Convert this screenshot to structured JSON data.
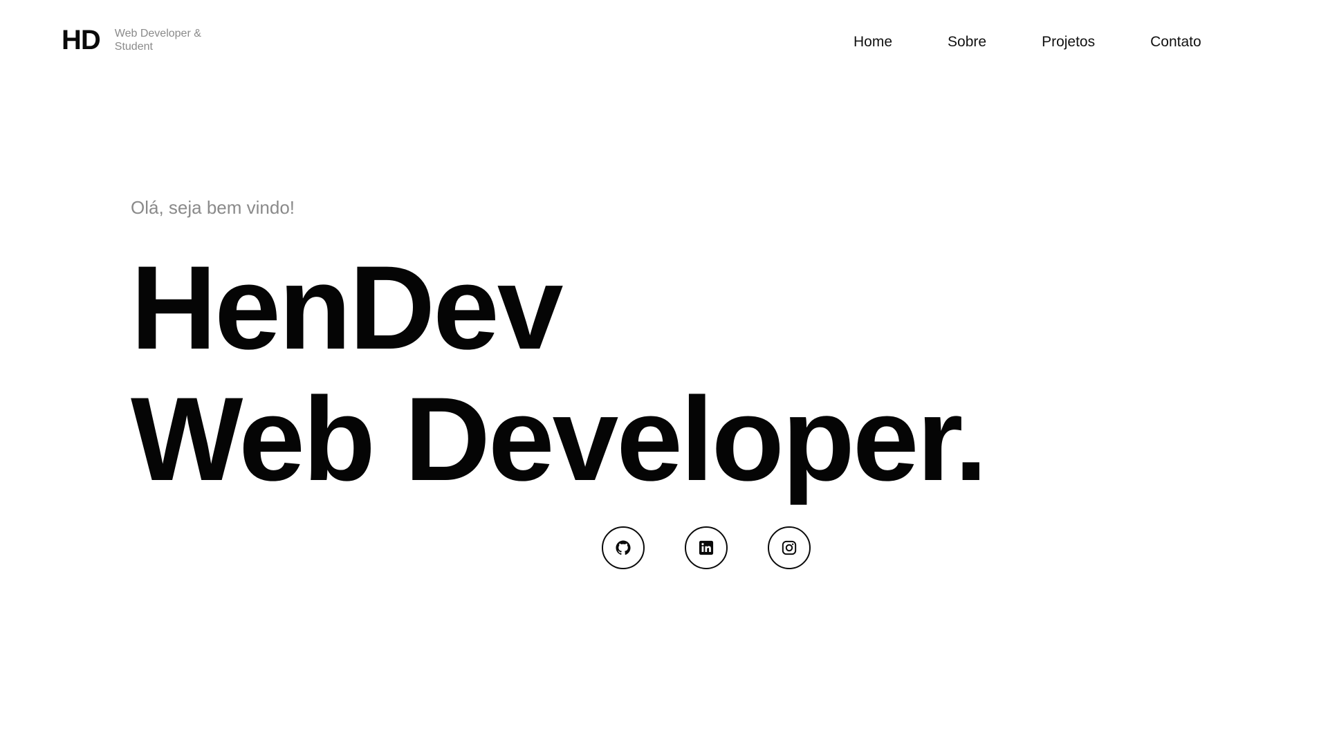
{
  "brand": {
    "mark": "HD",
    "tagline": "Web Developer & Student"
  },
  "nav": {
    "items": [
      {
        "label": "Home"
      },
      {
        "label": "Sobre"
      },
      {
        "label": "Projetos"
      },
      {
        "label": "Contato"
      }
    ]
  },
  "hero": {
    "greeting": "Olá, seja bem vindo!",
    "title_line1": "HenDev",
    "title_line2": "Web Developer."
  },
  "social": {
    "items": [
      {
        "icon": "github-icon"
      },
      {
        "icon": "linkedin-icon"
      },
      {
        "icon": "instagram-icon"
      }
    ]
  },
  "colors": {
    "background": "#ffffff",
    "text": "#0a0a0a",
    "muted": "#8a8a8a"
  }
}
